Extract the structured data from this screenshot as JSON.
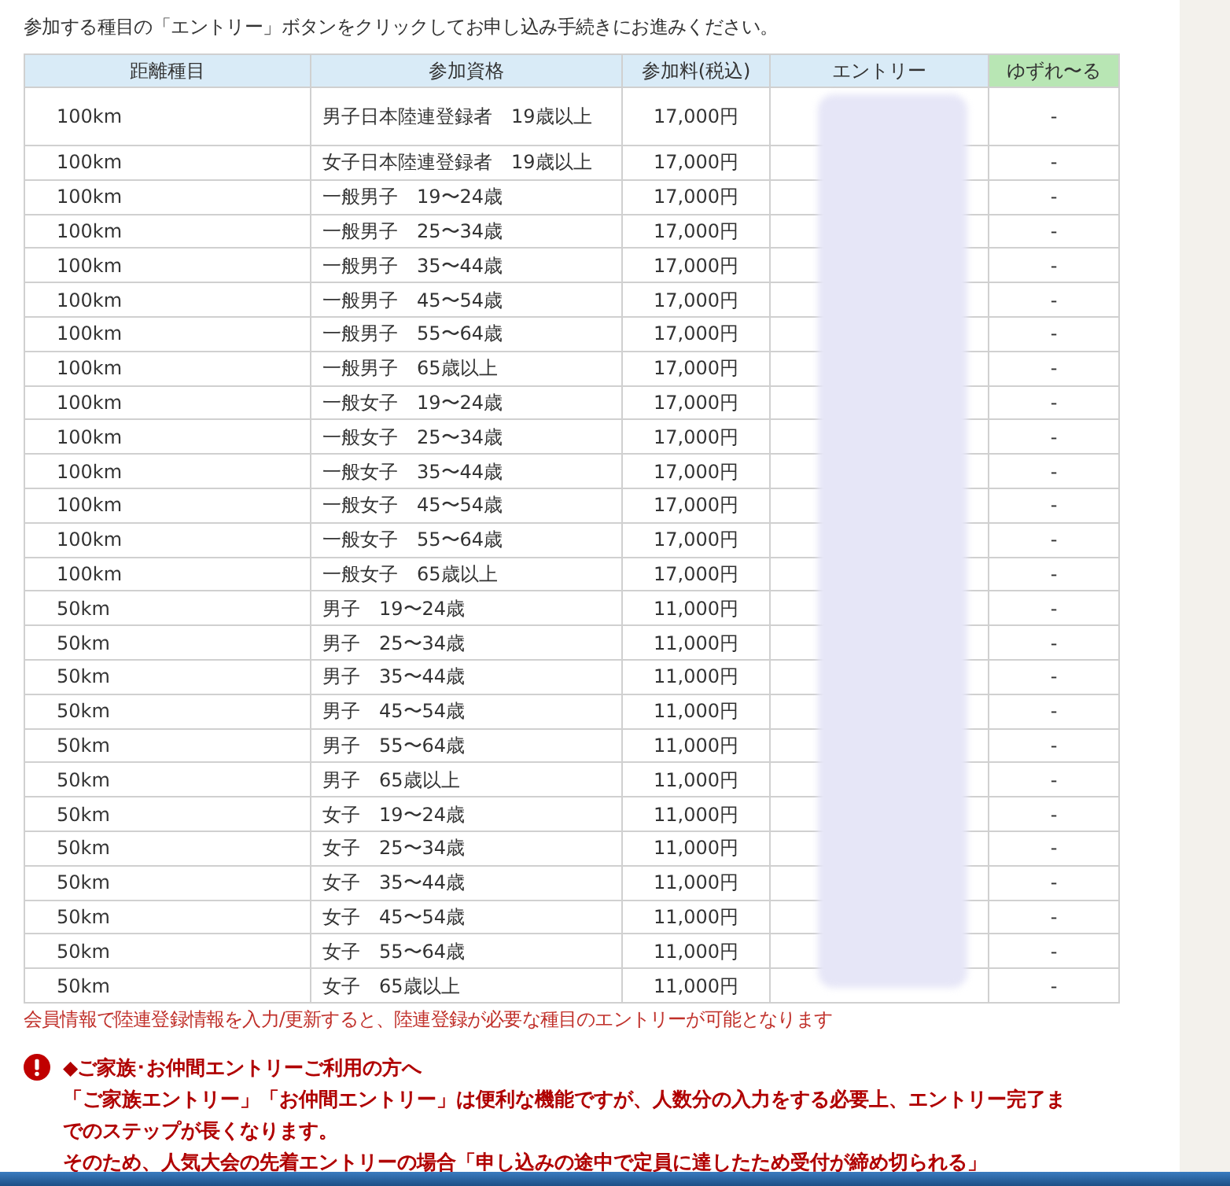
{
  "intro": "参加する種目の「エントリー」ボタンをクリックしてお申し込み手続きにお進みください。",
  "table": {
    "columns": [
      "距離種目",
      "参加資格",
      "参加料(税込)",
      "エントリー",
      "ゆずれ〜る"
    ],
    "rows": [
      {
        "distance": "100km",
        "qualification": "男子日本陸連登録者　19歳以上",
        "fee": "17,000円",
        "transfer": "-"
      },
      {
        "distance": "100km",
        "qualification": "女子日本陸連登録者　19歳以上",
        "fee": "17,000円",
        "transfer": "-"
      },
      {
        "distance": "100km",
        "qualification": "一般男子　19〜24歳",
        "fee": "17,000円",
        "transfer": "-"
      },
      {
        "distance": "100km",
        "qualification": "一般男子　25〜34歳",
        "fee": "17,000円",
        "transfer": "-"
      },
      {
        "distance": "100km",
        "qualification": "一般男子　35〜44歳",
        "fee": "17,000円",
        "transfer": "-"
      },
      {
        "distance": "100km",
        "qualification": "一般男子　45〜54歳",
        "fee": "17,000円",
        "transfer": "-"
      },
      {
        "distance": "100km",
        "qualification": "一般男子　55〜64歳",
        "fee": "17,000円",
        "transfer": "-"
      },
      {
        "distance": "100km",
        "qualification": "一般男子　65歳以上",
        "fee": "17,000円",
        "transfer": "-"
      },
      {
        "distance": "100km",
        "qualification": "一般女子　19〜24歳",
        "fee": "17,000円",
        "transfer": "-"
      },
      {
        "distance": "100km",
        "qualification": "一般女子　25〜34歳",
        "fee": "17,000円",
        "transfer": "-"
      },
      {
        "distance": "100km",
        "qualification": "一般女子　35〜44歳",
        "fee": "17,000円",
        "transfer": "-"
      },
      {
        "distance": "100km",
        "qualification": "一般女子　45〜54歳",
        "fee": "17,000円",
        "transfer": "-"
      },
      {
        "distance": "100km",
        "qualification": "一般女子　55〜64歳",
        "fee": "17,000円",
        "transfer": "-"
      },
      {
        "distance": "100km",
        "qualification": "一般女子　65歳以上",
        "fee": "17,000円",
        "transfer": "-"
      },
      {
        "distance": "50km",
        "qualification": "男子　19〜24歳",
        "fee": "11,000円",
        "transfer": "-"
      },
      {
        "distance": "50km",
        "qualification": "男子　25〜34歳",
        "fee": "11,000円",
        "transfer": "-"
      },
      {
        "distance": "50km",
        "qualification": "男子　35〜44歳",
        "fee": "11,000円",
        "transfer": "-"
      },
      {
        "distance": "50km",
        "qualification": "男子　45〜54歳",
        "fee": "11,000円",
        "transfer": "-"
      },
      {
        "distance": "50km",
        "qualification": "男子　55〜64歳",
        "fee": "11,000円",
        "transfer": "-"
      },
      {
        "distance": "50km",
        "qualification": "男子　65歳以上",
        "fee": "11,000円",
        "transfer": "-"
      },
      {
        "distance": "50km",
        "qualification": "女子　19〜24歳",
        "fee": "11,000円",
        "transfer": "-"
      },
      {
        "distance": "50km",
        "qualification": "女子　25〜34歳",
        "fee": "11,000円",
        "transfer": "-"
      },
      {
        "distance": "50km",
        "qualification": "女子　35〜44歳",
        "fee": "11,000円",
        "transfer": "-"
      },
      {
        "distance": "50km",
        "qualification": "女子　45〜54歳",
        "fee": "11,000円",
        "transfer": "-"
      },
      {
        "distance": "50km",
        "qualification": "女子　55〜64歳",
        "fee": "11,000円",
        "transfer": "-"
      },
      {
        "distance": "50km",
        "qualification": "女子　65歳以上",
        "fee": "11,000円",
        "transfer": "-"
      }
    ]
  },
  "note": "会員情報で陸連登録情報を入力/更新すると、陸連登録が必要な種目のエントリーが可能となります",
  "notice": {
    "title": "◆ご家族･お仲間エントリーご利用の方へ",
    "lines": [
      "「ご家族エントリー」「お仲間エントリー」は便利な機能ですが、人数分の入力をする必要上、エントリー完了までのステップが長くなります。",
      "そのため、人気大会の先着エントリーの場合「申し込みの途中で定員に達したため受付が締め切られる」"
    ]
  }
}
